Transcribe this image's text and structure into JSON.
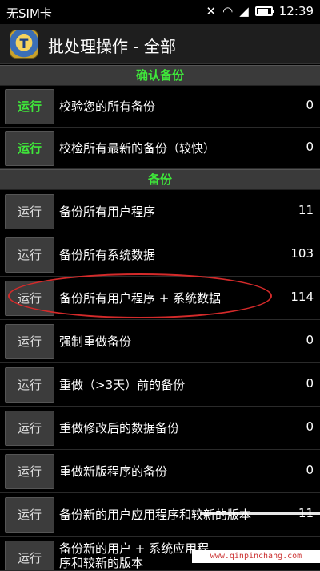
{
  "status_bar": {
    "carrier": "无SIM卡",
    "time": "12:39",
    "battery_level": 0.8,
    "icons": [
      "silent-icon",
      "wifi-icon",
      "no-signal-icon",
      "battery-icon"
    ]
  },
  "app_bar": {
    "title": "批处理操作 - 全部",
    "icon_letter": "T"
  },
  "sections": [
    {
      "header": "确认备份",
      "rows": [
        {
          "button": "运行",
          "label": "校验您的所有备份",
          "count": "0",
          "button_color": "#3fe83a"
        },
        {
          "button": "运行",
          "label": "校检所有最新的备份（较快）",
          "count": "0",
          "button_color": "#3fe83a"
        }
      ]
    },
    {
      "header": "备份",
      "rows": [
        {
          "button": "运行",
          "label": "备份所有用户程序",
          "count": "11"
        },
        {
          "button": "运行",
          "label": "备份所有系统数据",
          "count": "103"
        },
        {
          "button": "运行",
          "label": "备份所有用户程序 + 系统数据",
          "count": "114"
        },
        {
          "button": "运行",
          "label": "强制重做备份",
          "count": "0"
        },
        {
          "button": "运行",
          "label": "重做（>3天）前的备份",
          "count": "0"
        },
        {
          "button": "运行",
          "label": "重做修改后的数据备份",
          "count": "0"
        },
        {
          "button": "运行",
          "label": "重做新版程序的备份",
          "count": "0"
        },
        {
          "button": "运行",
          "label": "备份新的用户应用程序和较新的版本",
          "count": "11"
        },
        {
          "button": "运行",
          "label": "备份新的用户 + 系统应用程序和较新的版本",
          "count": ""
        }
      ]
    }
  ],
  "watermark": "www.qinpinchang.com"
}
